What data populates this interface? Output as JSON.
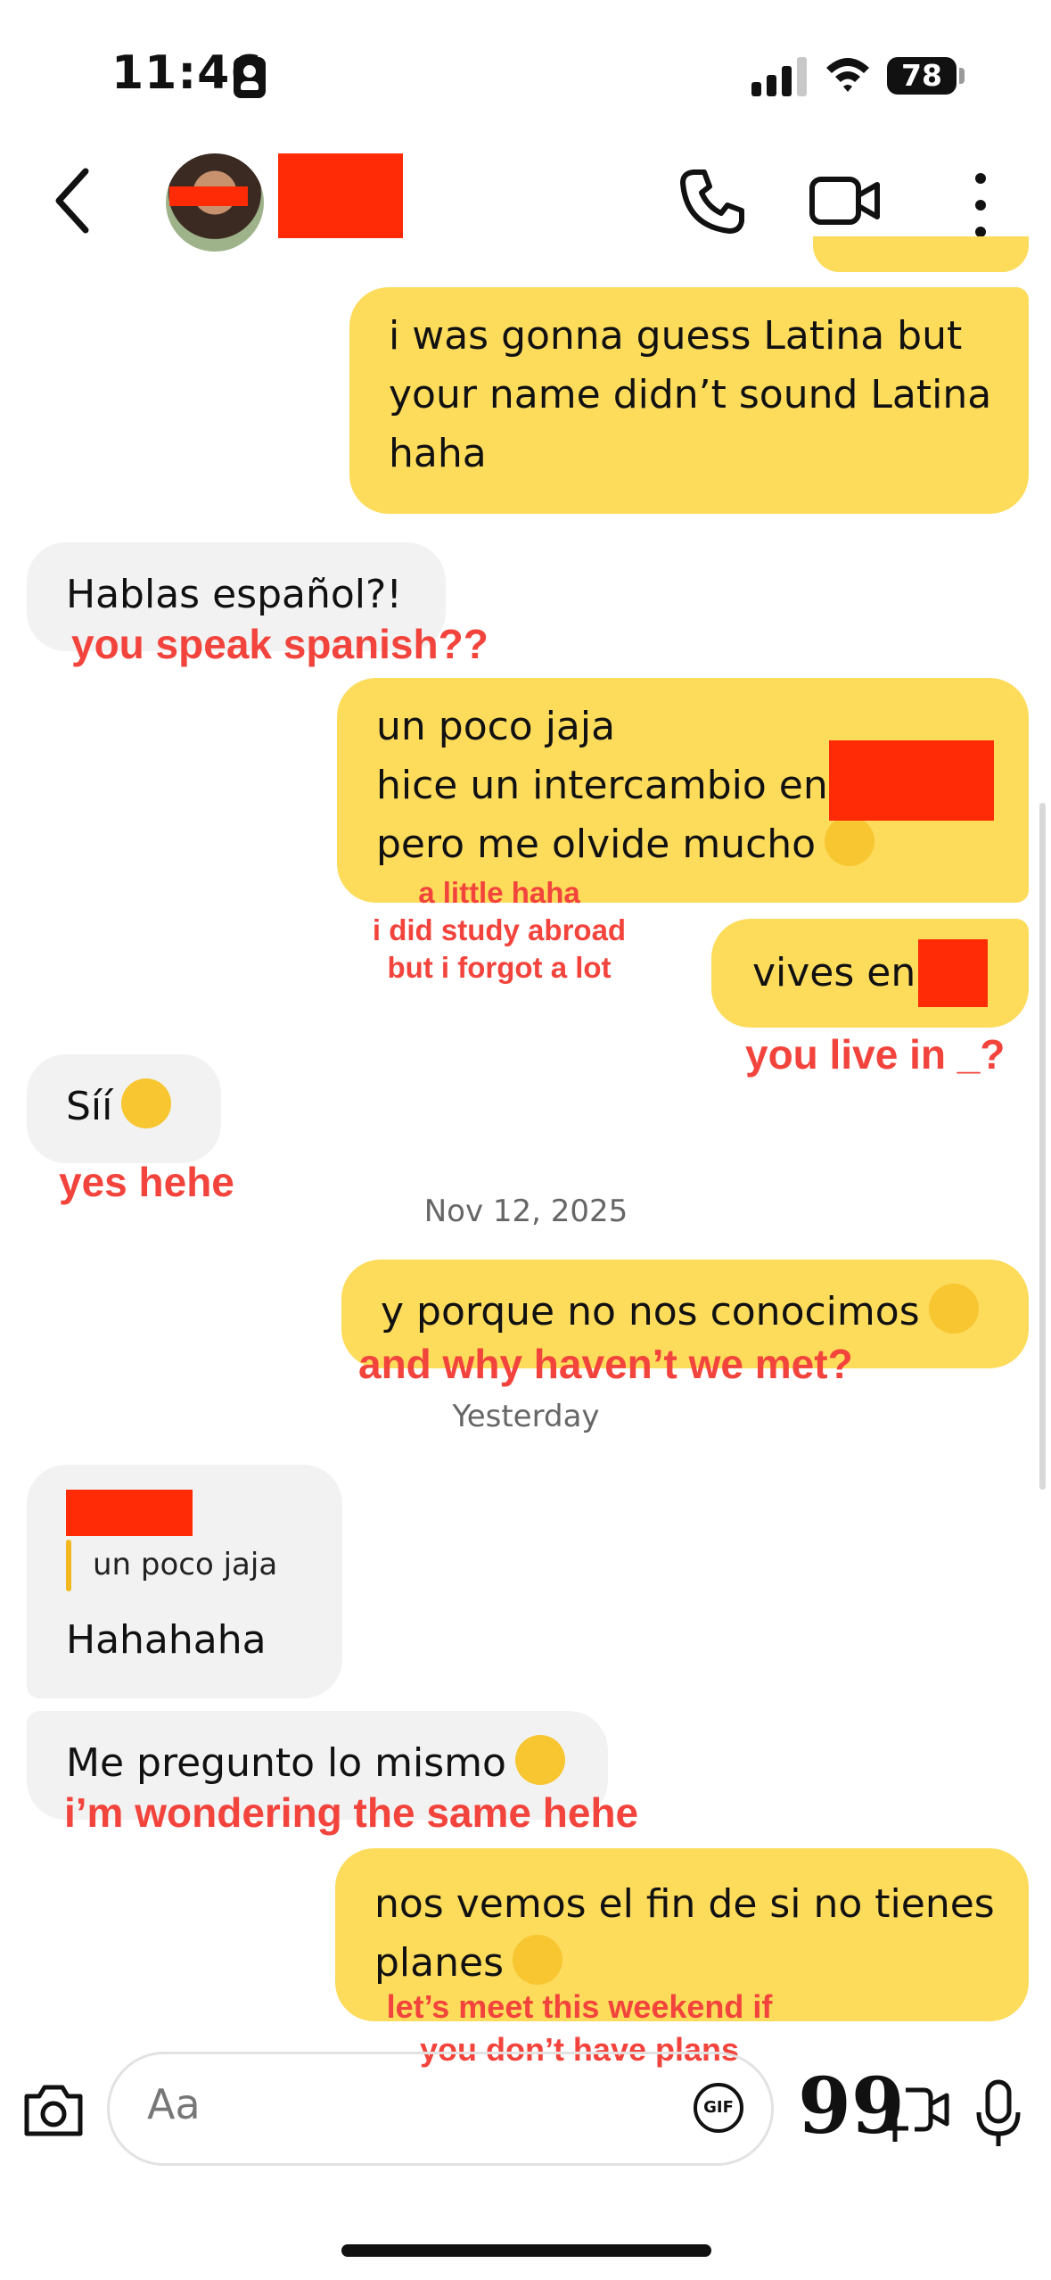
{
  "status_bar": {
    "time": "11:46",
    "battery": "78",
    "signal_bars": 3
  },
  "chat_header": {
    "contact_name_redacted": true,
    "icons": [
      "back-icon",
      "phone-icon",
      "video-icon",
      "more-icon"
    ]
  },
  "messages": [
    {
      "id": "m1",
      "from": "me",
      "lines": [
        "i was gonna guess Latina but",
        "your name didn’t sound Latina",
        "haha"
      ]
    },
    {
      "id": "m2",
      "from": "them",
      "lines": [
        "Hablas español?!"
      ],
      "annotation": "you speak spanish??"
    },
    {
      "id": "m3",
      "from": "me",
      "lines": [
        "un poco jaja",
        "hice un intercambio en",
        "pero me olvide mucho"
      ],
      "emoji": "sweat-smile-emoji",
      "annotation_lines": [
        "a little haha",
        "i did study abroad",
        "but i forgot a lot"
      ]
    },
    {
      "id": "m4",
      "from": "me",
      "lines": [
        "vives en"
      ],
      "annotation": "you live in _?"
    },
    {
      "id": "m5",
      "from": "them",
      "lines": [
        "Síí"
      ],
      "emoji": "hand-over-mouth-emoji",
      "annotation": "yes hehe"
    },
    {
      "id": "m6",
      "from": "me",
      "lines": [
        "y porque no nos conocimos"
      ],
      "emoji": "thinking-emoji",
      "annotation": "and why haven’t we met?"
    },
    {
      "id": "m7",
      "from": "them",
      "reply_quote": "un poco jaja",
      "lines": [
        "Hahahaha"
      ]
    },
    {
      "id": "m8",
      "from": "them",
      "lines": [
        "Me pregunto lo mismo"
      ],
      "emoji": "hand-over-mouth-emoji",
      "annotation": "i’m wondering the same hehe"
    },
    {
      "id": "m9",
      "from": "me",
      "lines": [
        "nos vemos el fin de si no tienes",
        "planes"
      ],
      "emoji": "wink-emoji",
      "annotation_lines": [
        "let’s meet this weekend if",
        "you don’t have plans"
      ]
    }
  ],
  "timestamps": {
    "date_1": "Nov 12, 2025",
    "date_2": "Yesterday"
  },
  "composer": {
    "placeholder": "Aa",
    "gif_label": "GIF",
    "quote_label": "99"
  },
  "colors": {
    "my_bubble": "#fddb5b",
    "their_bubble": "#f2f2f2",
    "annotation": "#f2443c",
    "redaction": "#ff2a06"
  }
}
